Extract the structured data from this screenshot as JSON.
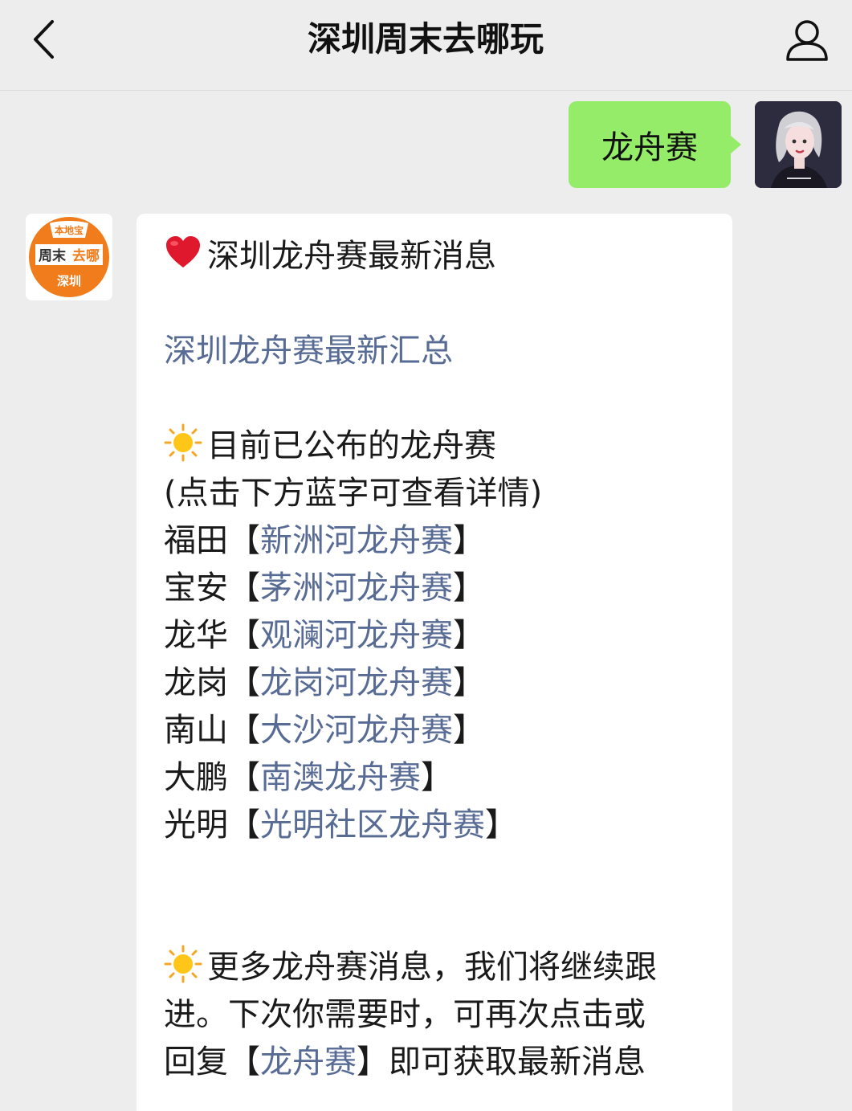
{
  "navbar": {
    "title": "深圳周末去哪玩",
    "back_icon": "chevron-left-icon",
    "profile_icon": "person-icon"
  },
  "outgoing_message": {
    "text": "龙舟赛"
  },
  "bot_avatar": {
    "top_text": "本地宝",
    "main_text_a": "周末",
    "main_text_b": "去哪",
    "city_text": "深圳"
  },
  "incoming_message": {
    "headline": "深圳龙舟赛最新消息",
    "summary_link": "深圳龙舟赛最新汇总",
    "published_title": "目前已公布的龙舟赛",
    "hint": "(点击下方蓝字可查看详情)",
    "races": [
      {
        "district": "福田",
        "name": "新洲河龙舟赛"
      },
      {
        "district": "宝安",
        "name": "茅洲河龙舟赛"
      },
      {
        "district": "龙华",
        "name": "观澜河龙舟赛"
      },
      {
        "district": "龙岗",
        "name": "龙岗河龙舟赛"
      },
      {
        "district": "南山",
        "name": "大沙河龙舟赛"
      },
      {
        "district": "大鹏",
        "name": "南澳龙舟赛"
      },
      {
        "district": "光明",
        "name": "光明社区龙舟赛"
      }
    ],
    "bracket_open": "【",
    "bracket_close": "】",
    "more_line1": "更多龙舟赛消息，我们将继续跟",
    "more_line2": "进。下次你需要时，可再次点击或",
    "more_line3_prefix": "回复",
    "more_keyword": "龙舟赛",
    "more_line3_suffix": "即可获取最新消息"
  },
  "colors": {
    "background": "#ededed",
    "outgoing_bubble": "#95ec69",
    "link": "#576b95",
    "logo_orange": "#f07c1b"
  },
  "icons": {
    "heart": "red-heart-icon",
    "sun": "sun-icon"
  }
}
